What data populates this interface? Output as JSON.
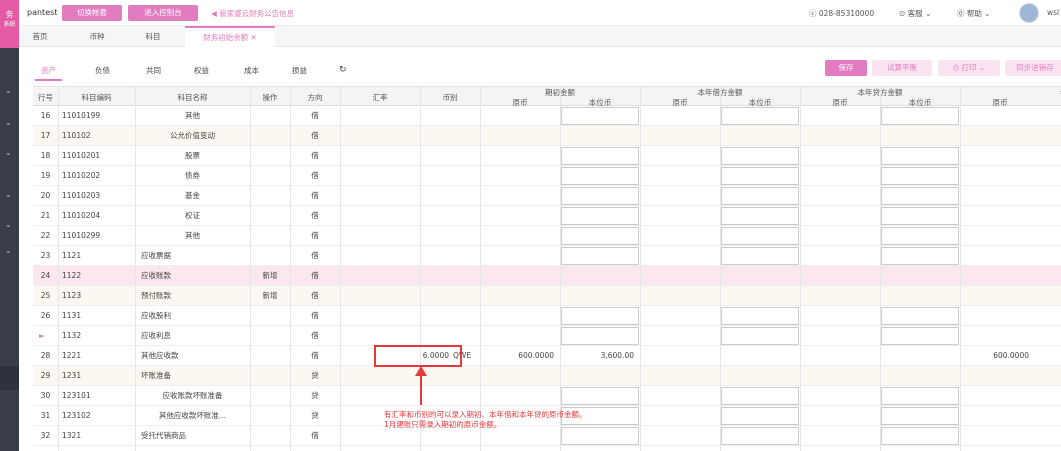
{
  "sidebar": {
    "logo_main": "务",
    "logo_sub": "系统"
  },
  "topbar": {
    "brand": "pantest",
    "switch_btn": "切换帐套",
    "console_btn": "进入控制台",
    "notice": "管家婆云财务公告信息",
    "phone": "028-85310000",
    "service": "客服",
    "help": "帮助",
    "user": "wsl"
  },
  "tabs": {
    "home": "首页",
    "currency": "币种",
    "subject": "科目",
    "active": "财务初始余额"
  },
  "filter": {
    "tabs": [
      "资产",
      "负债",
      "共同",
      "权益",
      "成本",
      "损益"
    ],
    "save": "保存",
    "trial": "试算平衡",
    "print": "打印",
    "sync": "同步进销存"
  },
  "header": {
    "rowno": "行号",
    "code": "科目编码",
    "name": "科目名称",
    "op": "操作",
    "dir": "方向",
    "rate": "汇率",
    "cur": "币别",
    "open": "期初金额",
    "debit": "本年借方金额",
    "credit": "本年贷方金额",
    "year": "年初余额",
    "orig": "原币",
    "local": "本位币"
  },
  "rows": [
    {
      "no": "16",
      "code": "11010199",
      "name": "其他",
      "op": "",
      "dir": "借"
    },
    {
      "no": "17",
      "code": "110102",
      "name": "公允价值变动",
      "op": "",
      "dir": "借"
    },
    {
      "no": "18",
      "code": "11010201",
      "name": "股票",
      "op": "",
      "dir": "借"
    },
    {
      "no": "19",
      "code": "11010202",
      "name": "债券",
      "op": "",
      "dir": "借"
    },
    {
      "no": "20",
      "code": "11010203",
      "name": "基金",
      "op": "",
      "dir": "借"
    },
    {
      "no": "21",
      "code": "11010204",
      "name": "权证",
      "op": "",
      "dir": "借"
    },
    {
      "no": "22",
      "code": "11010299",
      "name": "其他",
      "op": "",
      "dir": "借"
    },
    {
      "no": "23",
      "code": "1121",
      "name": "应收票据",
      "op": "",
      "dir": "借"
    },
    {
      "no": "24",
      "code": "1122",
      "name": "应收账款",
      "op": "新增",
      "dir": "借"
    },
    {
      "no": "25",
      "code": "1123",
      "name": "预付账款",
      "op": "新增",
      "dir": "借"
    },
    {
      "no": "26",
      "code": "1131",
      "name": "应收股利",
      "op": "",
      "dir": "借"
    },
    {
      "no": "",
      "code": "1132",
      "name": "应收利息",
      "op": "",
      "dir": "借"
    },
    {
      "no": "28",
      "code": "1221",
      "name": "其他应收款",
      "op": "",
      "dir": "借",
      "rate": "6.0000",
      "cur": "QWE",
      "open_orig": "600.0000",
      "open_local": "3,600.00",
      "year_orig": "600.0000"
    },
    {
      "no": "29",
      "code": "1231",
      "name": "坏账准备",
      "op": "",
      "dir": "贷"
    },
    {
      "no": "30",
      "code": "123101",
      "name": "应收账款坏账准备",
      "op": "",
      "dir": "贷"
    },
    {
      "no": "31",
      "code": "123102",
      "name": "其他应收款坏账准...",
      "op": "",
      "dir": "贷"
    },
    {
      "no": "32",
      "code": "1321",
      "name": "受托代销商品",
      "op": "",
      "dir": "借"
    }
  ],
  "annotation": {
    "line1": "有汇率和币别的可以录入期初、本年借和本年贷的原币金额。",
    "line2": "1月建账只需录入期初的原币金额。"
  },
  "colors": {
    "accent": "#e27cc1",
    "annotation": "#e4393c"
  }
}
